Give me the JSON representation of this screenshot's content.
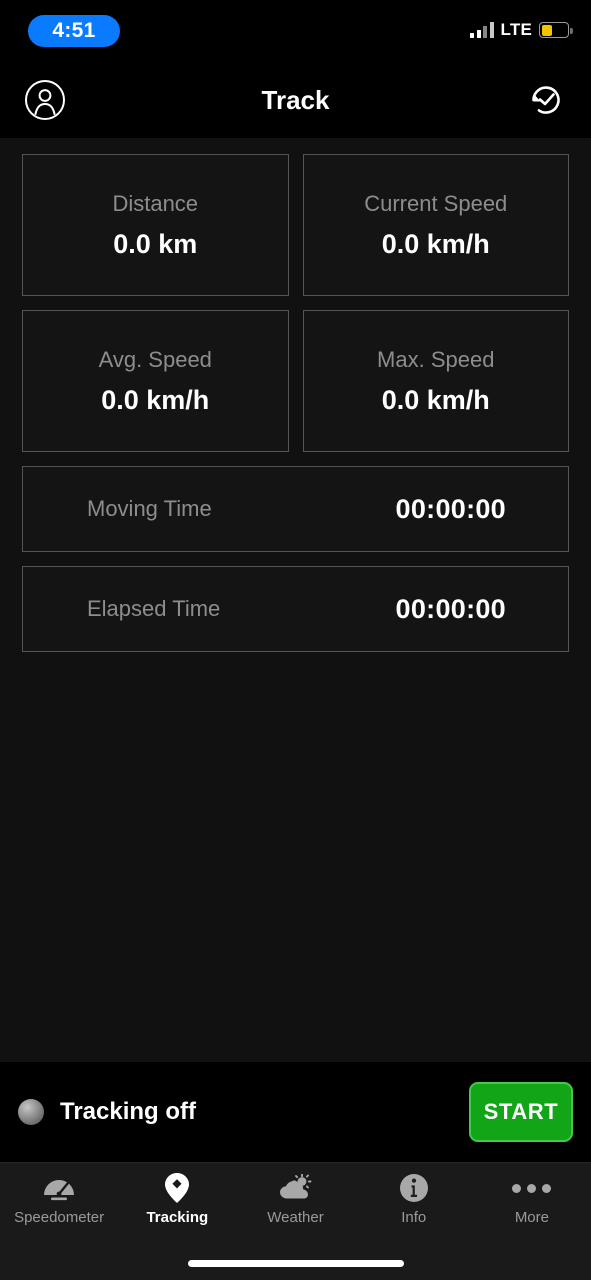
{
  "status_bar": {
    "time": "4:51",
    "carrier_network": "LTE",
    "signal_icon": "signal-bars-icon",
    "battery_icon": "battery-icon",
    "battery_level_percent": 42,
    "battery_color": "#f5c400",
    "time_pill_color": "#0a7aff"
  },
  "header": {
    "title": "Track",
    "left_icon": "profile-icon",
    "right_icon": "history-icon"
  },
  "stats": {
    "grid": [
      [
        {
          "label": "Distance",
          "value": "0.0 km"
        },
        {
          "label": "Current Speed",
          "value": "0.0 km/h"
        }
      ],
      [
        {
          "label": "Avg. Speed",
          "value": "0.0 km/h"
        },
        {
          "label": "Max. Speed",
          "value": "0.0 km/h"
        }
      ]
    ],
    "rows": [
      {
        "label": "Moving Time",
        "value": "00:00:00"
      },
      {
        "label": "Elapsed Time",
        "value": "00:00:00"
      }
    ]
  },
  "action_bar": {
    "status_text": "Tracking off",
    "status_indicator_icon": "status-dot-icon",
    "start_label": "START",
    "start_color": "#12a518"
  },
  "tab_bar": {
    "items": [
      {
        "label": "Speedometer",
        "icon": "speedometer-icon",
        "active": false
      },
      {
        "label": "Tracking",
        "icon": "map-pin-icon",
        "active": true
      },
      {
        "label": "Weather",
        "icon": "cloud-sun-icon",
        "active": false
      },
      {
        "label": "Info",
        "icon": "info-circle-icon",
        "active": false
      },
      {
        "label": "More",
        "icon": "more-dots-icon",
        "active": false
      }
    ]
  }
}
